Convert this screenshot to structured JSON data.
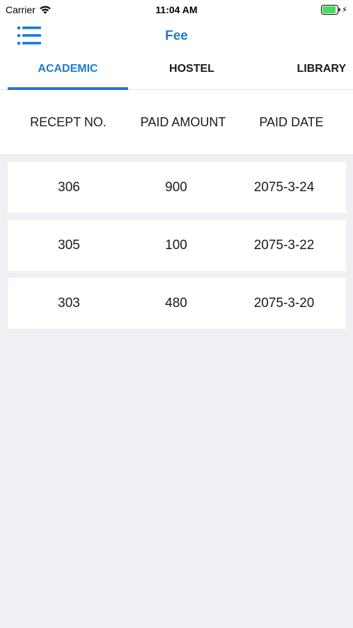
{
  "status_bar": {
    "carrier": "Carrier",
    "time": "11:04 AM",
    "wifi_icon": "wifi-icon",
    "battery_icon": "battery-charging-icon"
  },
  "nav": {
    "title": "Fee",
    "menu_icon": "menu-list-icon"
  },
  "colors": {
    "accent": "#1b7ad6",
    "background": "#efeff4",
    "card": "#ffffff",
    "battery_green": "#4cd964"
  },
  "tabs": [
    {
      "label": "ACADEMIC",
      "active": true
    },
    {
      "label": "HOSTEL",
      "active": false
    },
    {
      "label": "LIBRARY",
      "active": false
    }
  ],
  "table": {
    "headers": [
      "RECEPT NO.",
      "PAID AMOUNT",
      "PAID DATE"
    ],
    "rows": [
      {
        "receipt": "306",
        "amount": "900",
        "date": "2075-3-24"
      },
      {
        "receipt": "305",
        "amount": "100",
        "date": "2075-3-22"
      },
      {
        "receipt": "303",
        "amount": "480",
        "date": "2075-3-20"
      }
    ]
  }
}
